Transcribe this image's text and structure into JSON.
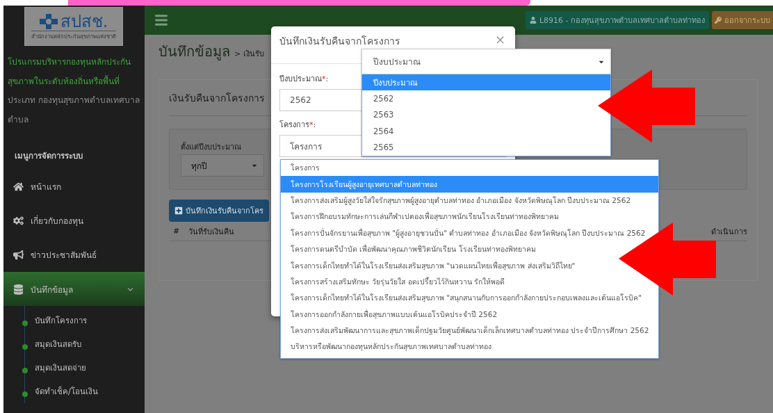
{
  "logo": {
    "name": "สปสช.",
    "subtitle": "สำนักงานหลักประกันสุขภาพแห่งชาติ"
  },
  "sidebar": {
    "program_title": [
      "โปรแกรมบริหารกองทุนหลักประกัน",
      "สุขภาพในระดับท้องถิ่นหรือพื้นที่"
    ],
    "fund_type": [
      "ประเภท กองทุนสุขภาพตำบลเทศบาล",
      "ตำบล"
    ],
    "menu_heading": "เมนูการจัดการระบบ",
    "items": [
      {
        "label": "หน้าแรก",
        "selected": false
      },
      {
        "label": "เกี่ยวกับกองทุน",
        "selected": false
      },
      {
        "label": "ข่าวประชาสัมพันธ์",
        "selected": false
      },
      {
        "label": "บันทึกข้อมูล",
        "selected": true,
        "expanded": true,
        "children": [
          {
            "label": "บันทึกโครงการ"
          },
          {
            "label": "สมุดเงินสดรับ"
          },
          {
            "label": "สมุดเงินสดจ่าย"
          },
          {
            "label": "จัดทำเช็ค/โอนเงิน"
          }
        ]
      }
    ]
  },
  "header": {
    "user": "L8916 - กองทุนสุขภาพตำบลเทศบาลตำบลท่าทอง",
    "logout": "ออกจากระบบ"
  },
  "page": {
    "title": "บันทึกข้อมูล",
    "breadcrumb": "> เงินรับ",
    "panel_title": "เงินรับคืนจากโครงการ",
    "filter": {
      "label": "ตั้งแต่ปีงบประมาณ",
      "value": "ทุกปี"
    },
    "add_button": "บันทึกเงินรับคืนจากโคร",
    "table": {
      "columns": [
        "#",
        "วันที่รับเงินคืน",
        "ดำเนินการ"
      ]
    }
  },
  "modal": {
    "title": "บันทึกเงินรับคืนจากโครงการ",
    "close": "×",
    "fields": [
      {
        "label": "ปีงบประมาณ",
        "mark": "*",
        "suffix": " :",
        "value": "2562"
      },
      {
        "label": "โครงการ",
        "mark": "*",
        "suffix": " :",
        "value": "โครงการ"
      }
    ]
  },
  "year_dropdown": {
    "value": "ปีงบประมาณ",
    "options": [
      {
        "label": "ปีงบประมาณ",
        "selected": true
      },
      {
        "label": "2562",
        "selected": false
      },
      {
        "label": "2563",
        "selected": false
      },
      {
        "label": "2564",
        "selected": false
      },
      {
        "label": "2565",
        "selected": false
      }
    ]
  },
  "project_dropdown": {
    "options": [
      {
        "label": "โครงการ",
        "selected": false
      },
      {
        "label": "โครงการโรงเรียนผู้สูงอายุเทศบาลตำบลท่าทอง",
        "selected": true
      },
      {
        "label": "โครงการส่งเสริมผู้สูงวัยใส่ใจรักสุขภาพผู้สูงอายุตำบลท่าทอง อำเภอเมือง จังหวัดพิษณุโลก ปีงบประมาณ 2562",
        "selected": false
      },
      {
        "label": "โครงการฝึกอบรมทักษะการเล่นกีฬาเปตองเพื่อสุขภาพนักเรียนโรงเรียนท่าทองพิทยาคม",
        "selected": false
      },
      {
        "label": "โครงการปั่นจักรยานเพื่อสุขภาพ \"ผู้สูงอายุชวนปั่น\" ตำบลท่าทอง อำเภอเมือง จังหวัดพิษณุโลก ปีงบประมาณ 2562",
        "selected": false
      },
      {
        "label": "โครงการดนตรีบำบัด เพื่อพัฒนาคุณภาพชีวิตนักเรียน โรงเรียนท่าทองพิทยาคม",
        "selected": false
      },
      {
        "label": "โครงการเด็กไทยทำได้ในโรงเรียนส่งเสริมสุขภาพ \"นวดแผนไทยเพื่อสุขภาพ ส่งเสริมวิถีไทย\"",
        "selected": false
      },
      {
        "label": "โครงการสร้างเสริมทักษะ วัยรุ่นวัยใส อดเปรี้ยวไว้กินหวาน รักให้พอดี",
        "selected": false
      },
      {
        "label": "โครงการเด็กไทยทำได้ในโรงเรียนส่งเสริมสุขภาพ \"สนุกสนานกับการออกกำลังกายประกอบเพลงและเต้นแอโรบิค\"",
        "selected": false
      },
      {
        "label": "โครงการออกกำลังกายเพื่อสุขภาพแบบเต้นแอโรบิคประจำปี 2562",
        "selected": false
      },
      {
        "label": "โครงการส่งเสริมพัฒนาการและสุขภาพเด็กปฐมวัยศูนย์พัฒนาเด็กเล็กเทศบาลตำบลท่าทอง ประจำปีการศึกษา 2562",
        "selected": false
      },
      {
        "label": "บริหารหรือพัฒนากองทุนหลักประกันสุขภาพเทศบาลตำบลท่าทอง",
        "selected": false
      }
    ]
  }
}
